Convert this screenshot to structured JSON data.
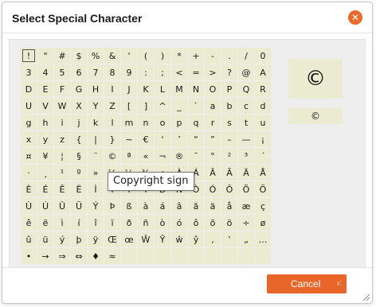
{
  "dialog": {
    "title": "Select Special Character",
    "close_glyph": "✕",
    "tooltip": "Copyright sign",
    "preview_char": "©",
    "preview_small": "©",
    "cancel_label": "Cancel",
    "cancel_shortcut": "›:"
  },
  "characters": [
    [
      "!",
      "\"",
      "#",
      "$",
      "%",
      "&",
      "'",
      "(",
      ")",
      "*",
      "+",
      "-",
      ".",
      "/",
      "0",
      "1",
      "2"
    ],
    [
      "3",
      "4",
      "5",
      "6",
      "7",
      "8",
      "9",
      ":",
      ";",
      "<",
      "=",
      ">",
      "?",
      "@",
      "A",
      "B",
      "C"
    ],
    [
      "D",
      "E",
      "F",
      "G",
      "H",
      "I",
      "J",
      "K",
      "L",
      "M",
      "N",
      "O",
      "P",
      "Q",
      "R",
      "S",
      "T"
    ],
    [
      "U",
      "V",
      "W",
      "X",
      "Y",
      "Z",
      "[",
      "]",
      "^",
      "_",
      "`",
      "a",
      "b",
      "c",
      "d",
      "e",
      "f"
    ],
    [
      "g",
      "h",
      "i",
      "j",
      "k",
      "l",
      "m",
      "n",
      "o",
      "p",
      "q",
      "r",
      "s",
      "t",
      "u",
      "v",
      "w"
    ],
    [
      "x",
      "y",
      "z",
      "{",
      "|",
      "}",
      "~",
      "€",
      "‘",
      "’",
      "“",
      "”",
      "–",
      "—",
      "¡",
      "¢",
      "£"
    ],
    [
      "¤",
      "¥",
      "¦",
      "§",
      "¨",
      "©",
      "ª",
      "«",
      "¬",
      "®",
      "¯",
      "°",
      "²",
      "³",
      "´",
      "µ",
      "¶"
    ],
    [
      "·",
      "¸",
      "¹",
      "º",
      "»",
      "¼",
      "½",
      "¾",
      "¿",
      "À",
      "Á",
      "Â",
      "Ã",
      "Ä",
      "Å",
      "Æ",
      "Ç"
    ],
    [
      "È",
      "É",
      "Ê",
      "Ë",
      "Ì",
      "Í",
      "Î",
      "Ï",
      "Ð",
      "Ñ",
      "Ò",
      "Ó",
      "Ô",
      "Õ",
      "Ö",
      "×",
      "Ø"
    ],
    [
      "Ù",
      "Ú",
      "Û",
      "Ü",
      "Ý",
      "Þ",
      "ß",
      "à",
      "á",
      "â",
      "ã",
      "ä",
      "å",
      "æ",
      "ç",
      "è",
      "é"
    ],
    [
      "ê",
      "ë",
      "ì",
      "í",
      "î",
      "ï",
      "ð",
      "ñ",
      "ò",
      "ó",
      "ô",
      "õ",
      "ö",
      "÷",
      "ø",
      "ù",
      "ú"
    ],
    [
      "û",
      "ü",
      "ý",
      "þ",
      "ÿ",
      "Œ",
      "œ",
      "Ŵ",
      "Ŷ",
      "ŵ",
      "ŷ",
      "‚",
      "‛",
      "„",
      "…",
      "™",
      "►"
    ],
    [
      "•",
      "→",
      "⇒",
      "⇔",
      "♦",
      "≈",
      "",
      "",
      "",
      "",
      "",
      "",
      "",
      "",
      "",
      "",
      ""
    ]
  ],
  "selected": "!"
}
